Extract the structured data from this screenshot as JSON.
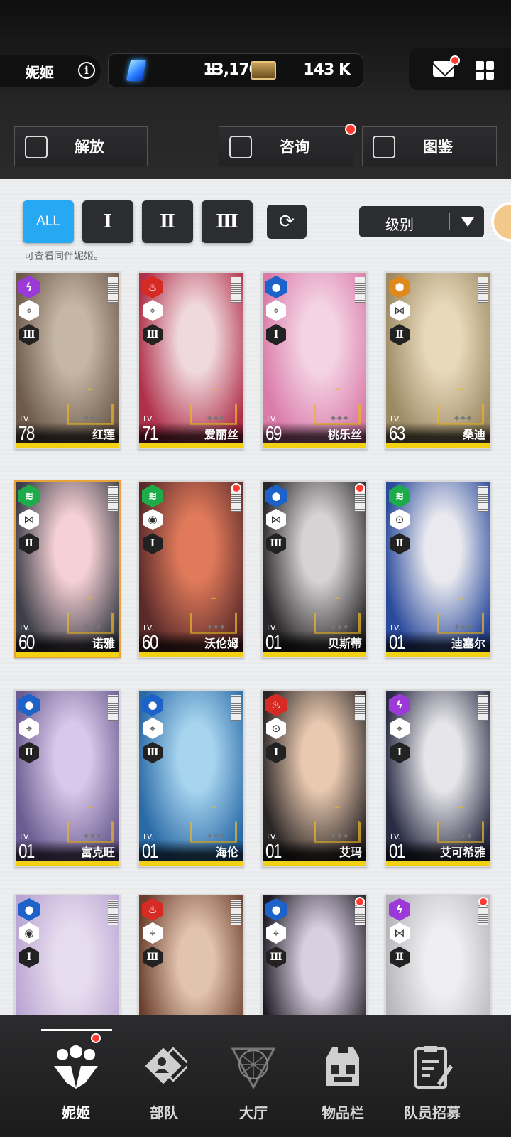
{
  "header": {
    "title": "妮姬",
    "gems": "13,170",
    "gems_plus": "+",
    "tickets": "143 K"
  },
  "menu": {
    "liberation": "解放",
    "consult": "咨询",
    "codex": "图鉴"
  },
  "filters": {
    "all": "ALL",
    "burst_1": "Ⅰ",
    "burst_2": "Ⅱ",
    "burst_3": "Ⅲ",
    "sort_label": "级别",
    "hint": "可查看同伴妮姬。"
  },
  "cards": [
    {
      "name": "红莲",
      "lv_label": "LV.",
      "level": "78",
      "element": "electric",
      "element_color": "#9b3ad8",
      "weapon": "⌖",
      "burst": "Ⅲ",
      "new": false,
      "bg": [
        "#c6b7a5",
        "#6d5a4b"
      ]
    },
    {
      "name": "爱丽丝",
      "lv_label": "LV.",
      "level": "71",
      "element": "fire",
      "element_color": "#d62b25",
      "weapon": "⌖",
      "burst": "Ⅲ",
      "new": false,
      "bg": [
        "#f0d9dd",
        "#b0304a"
      ]
    },
    {
      "name": "桃乐丝",
      "lv_label": "LV.",
      "level": "69",
      "element": "water",
      "element_color": "#1c62c9",
      "weapon": "⌖",
      "burst": "Ⅰ",
      "new": false,
      "bg": [
        "#f4d3e4",
        "#d97aa9"
      ]
    },
    {
      "name": "桑迪",
      "lv_label": "LV.",
      "level": "63",
      "element": "iron",
      "element_color": "#e0891b",
      "weapon": "⋈",
      "burst": "Ⅱ",
      "new": false,
      "bg": [
        "#e8d9bb",
        "#9c8a64"
      ]
    },
    {
      "name": "诺雅",
      "lv_label": "LV.",
      "level": "60",
      "element": "wind",
      "element_color": "#1cad4a",
      "weapon": "⋈",
      "burst": "Ⅱ",
      "new": false,
      "bg": [
        "#f5d0d4",
        "#3d3e48"
      ]
    },
    {
      "name": "沃伦姆",
      "lv_label": "LV.",
      "level": "60",
      "element": "wind",
      "element_color": "#1cad4a",
      "weapon": "◉",
      "burst": "Ⅰ",
      "new": true,
      "bg": [
        "#e07a5a",
        "#5a2a2a"
      ]
    },
    {
      "name": "贝斯蒂",
      "lv_label": "LV.",
      "level": "01",
      "element": "water",
      "element_color": "#1c62c9",
      "weapon": "⋈",
      "burst": "Ⅲ",
      "new": true,
      "bg": [
        "#d7d3d5",
        "#282628"
      ]
    },
    {
      "name": "迪塞尔",
      "lv_label": "LV.",
      "level": "01",
      "element": "wind",
      "element_color": "#1cad4a",
      "weapon": "⊙",
      "burst": "Ⅱ",
      "new": false,
      "bg": [
        "#e9e9ef",
        "#2a4a9c"
      ]
    },
    {
      "name": "富克旺",
      "lv_label": "LV.",
      "level": "01",
      "element": "water",
      "element_color": "#1c62c9",
      "weapon": "⌖",
      "burst": "Ⅱ",
      "new": false,
      "bg": [
        "#d8c8ea",
        "#6b5b90"
      ]
    },
    {
      "name": "海伦",
      "lv_label": "LV.",
      "level": "01",
      "element": "water",
      "element_color": "#1c62c9",
      "weapon": "⌖",
      "burst": "Ⅲ",
      "new": false,
      "bg": [
        "#a7d4ef",
        "#2a6aa6"
      ]
    },
    {
      "name": "艾玛",
      "lv_label": "LV.",
      "level": "01",
      "element": "fire",
      "element_color": "#d62b25",
      "weapon": "⊙",
      "burst": "Ⅰ",
      "new": false,
      "bg": [
        "#e9c9b0",
        "#2b2626"
      ]
    },
    {
      "name": "艾可希雅",
      "lv_label": "LV.",
      "level": "01",
      "element": "electric",
      "element_color": "#9b3ad8",
      "weapon": "⌖",
      "burst": "Ⅰ",
      "new": false,
      "bg": [
        "#e6e6ea",
        "#2a2c44"
      ]
    },
    {
      "name": "",
      "lv_label": "",
      "level": "",
      "element": "water",
      "element_color": "#1c62c9",
      "weapon": "◉",
      "burst": "Ⅰ",
      "new": false,
      "bg": [
        "#e7dcef",
        "#b9a5d2"
      ]
    },
    {
      "name": "",
      "lv_label": "",
      "level": "",
      "element": "fire",
      "element_color": "#d62b25",
      "weapon": "⌖",
      "burst": "Ⅲ",
      "new": false,
      "bg": [
        "#e2c3ad",
        "#6a3d2c"
      ]
    },
    {
      "name": "",
      "lv_label": "",
      "level": "",
      "element": "water",
      "element_color": "#1c62c9",
      "weapon": "⌖",
      "burst": "Ⅲ",
      "new": true,
      "bg": [
        "#d9cfe0",
        "#1e1a24"
      ]
    },
    {
      "name": "",
      "lv_label": "",
      "level": "",
      "element": "electric",
      "element_color": "#9b3ad8",
      "weapon": "⋈",
      "burst": "Ⅱ",
      "new": true,
      "bg": [
        "#efeef0",
        "#b6b4ba"
      ]
    }
  ],
  "element_glyphs": {
    "electric": "ϟ",
    "fire": "♨",
    "water": "●",
    "wind": "≋",
    "iron": "⬢"
  },
  "nav": {
    "nikke": "妮姬",
    "squad": "部队",
    "lobby": "大厅",
    "inventory": "物品栏",
    "recruit": "队员招募"
  },
  "colors": {
    "accent_blue": "#27a8f2",
    "notify_red": "#ff3b2f",
    "gold": "#f2d112"
  }
}
